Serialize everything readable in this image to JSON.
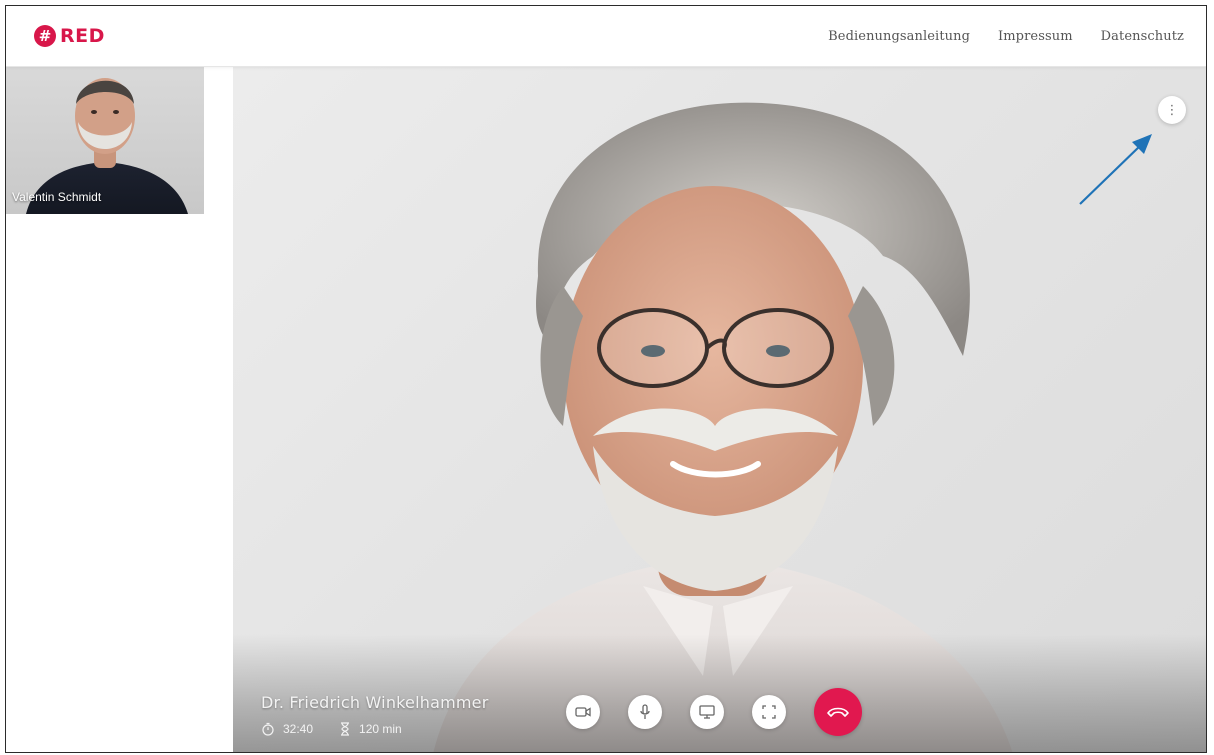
{
  "brand": {
    "name": "RED",
    "color": "#d8174a"
  },
  "nav": {
    "items": [
      "Bedienungsanleitung",
      "Impressum",
      "Datenschutz"
    ]
  },
  "self_preview": {
    "name": "Valentin Schmidt"
  },
  "call": {
    "caller_name": "Dr. Friedrich Winkelhammer",
    "elapsed": "32:40",
    "duration": "120 min",
    "hangup_color": "#e1184f"
  },
  "controls": {
    "icons": [
      "camera-icon",
      "microphone-icon",
      "screen-share-icon",
      "fullscreen-icon",
      "hang-up-icon"
    ]
  },
  "overlay": {
    "more_icon": "vertical-dots-icon",
    "annotation_color": "#1f73b7"
  }
}
